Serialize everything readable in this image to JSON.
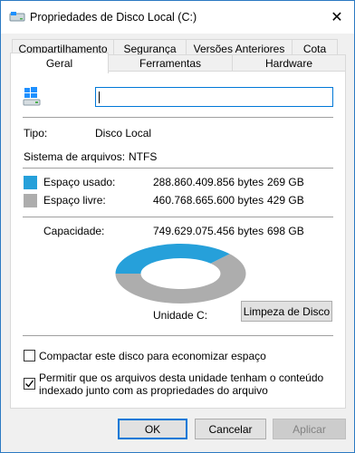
{
  "window": {
    "title": "Propriedades de Disco Local (C:)"
  },
  "tabs_row1": [
    {
      "label": "Compartilhamento"
    },
    {
      "label": "Segurança"
    },
    {
      "label": "Versões Anteriores"
    },
    {
      "label": "Cota"
    }
  ],
  "tabs_row2": [
    {
      "label": "Geral"
    },
    {
      "label": "Ferramentas"
    },
    {
      "label": "Hardware"
    }
  ],
  "general": {
    "name_value": "",
    "type_label": "Tipo:",
    "type_value": "Disco Local",
    "fs_label": "Sistema de arquivos:",
    "fs_value": "NTFS",
    "used_label": "Espaço usado:",
    "used_bytes": "288.860.409.856 bytes",
    "used_gb": "269 GB",
    "free_label": "Espaço livre:",
    "free_bytes": "460.768.665.600 bytes",
    "free_gb": "429 GB",
    "capacity_label": "Capacidade:",
    "capacity_bytes": "749.629.075.456 bytes",
    "capacity_gb": "698 GB",
    "drive_label": "Unidade C:",
    "cleanup_button": "Limpeza de Disco",
    "used_fraction": 0.3853,
    "used_color": "#26a0da",
    "free_color": "#adadad"
  },
  "options": {
    "compress_label": "Compactar este disco para economizar espaço",
    "compress_checked": false,
    "index_label_line1": "Permitir que os arquivos desta unidade tenham o conteúdo",
    "index_label_line2": "indexado junto com as propriedades do arquivo",
    "index_checked": true
  },
  "buttons": {
    "ok": "OK",
    "cancel": "Cancelar",
    "apply": "Aplicar"
  },
  "icons": {
    "title": "drive-icon",
    "drive": "windows-drive-icon",
    "close": "close-icon",
    "check": "checkmark-icon"
  }
}
